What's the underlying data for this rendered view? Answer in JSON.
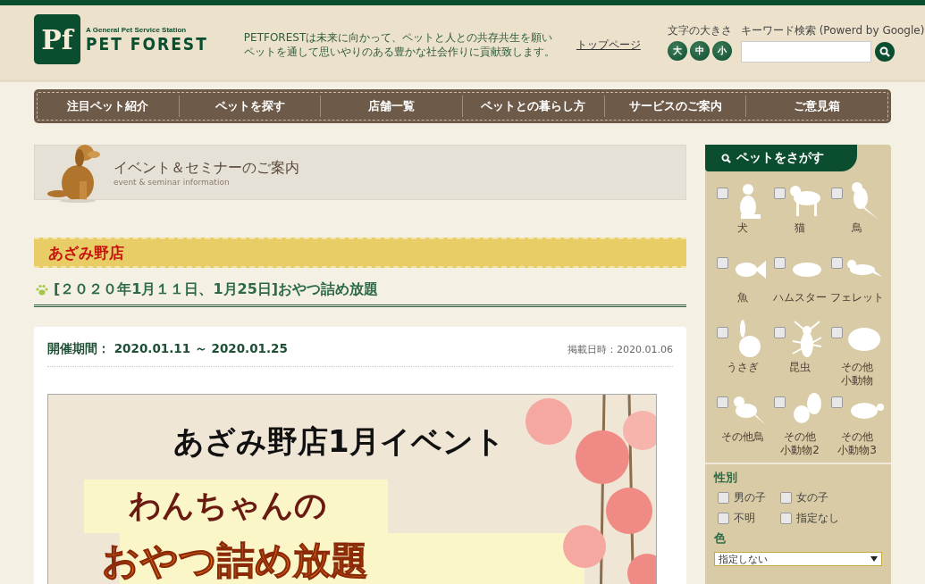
{
  "header": {
    "logo_mark": "Pf",
    "logo_tagline": "A General Pet Service Station",
    "logo_name": "PET FOREST",
    "message": [
      "PETFORESTは未来に向かって、ペットと人との共存共生を願い",
      "ペットを通して思いやりのある豊かな社会作りに貢献致します。"
    ],
    "top_link": "トップページ",
    "font_size_label": "文字の大きさ",
    "font_sizes": [
      "大",
      "中",
      "小"
    ],
    "search_label": "キーワード検索 (Powerd by Google)"
  },
  "nav": [
    "注目ペット紹介",
    "ペットを探す",
    "店舗一覧",
    "ペットとの暮らし方",
    "サービスのご案内",
    "ご意見箱"
  ],
  "banner": {
    "title": "イベント＆セミナーのご案内",
    "subtitle": "event & seminar information"
  },
  "store": "あざみ野店",
  "event": {
    "title": "[２０２０年1月１１日、1月25日]おやつ詰め放題",
    "period_label": "開催期間：",
    "period": "2020.01.11 ～ 2020.01.25",
    "posted": "掲載日時：2020.01.06",
    "poster": [
      "あざみ野店1月イベント",
      "わんちゃんの",
      "おやつ詰め放題"
    ]
  },
  "sidebar": {
    "title": "ペットをさがす",
    "pets": [
      {
        "label": [
          "犬"
        ],
        "checked": false
      },
      {
        "label": [
          "猫"
        ],
        "checked": false
      },
      {
        "label": [
          "鳥"
        ],
        "checked": false
      },
      {
        "label": [
          "魚"
        ],
        "checked": false
      },
      {
        "label": [
          "ハムスター"
        ],
        "checked": false
      },
      {
        "label": [
          "フェレット"
        ],
        "checked": false
      },
      {
        "label": [
          "うさぎ"
        ],
        "checked": false
      },
      {
        "label": [
          "昆虫"
        ],
        "checked": false
      },
      {
        "label": [
          "その他",
          "小動物"
        ],
        "checked": false
      },
      {
        "label": [
          "その他鳥"
        ],
        "checked": false
      },
      {
        "label": [
          "その他",
          "小動物2"
        ],
        "checked": false
      },
      {
        "label": [
          "その他",
          "小動物3"
        ],
        "checked": false
      }
    ],
    "gender_label": "性別",
    "genders": [
      {
        "label": "男の子",
        "checked": false
      },
      {
        "label": "女の子",
        "checked": false
      },
      {
        "label": "不明",
        "checked": false
      },
      {
        "label": "指定なし",
        "checked": false
      }
    ],
    "color_label": "色",
    "color_value": "指定しない"
  }
}
